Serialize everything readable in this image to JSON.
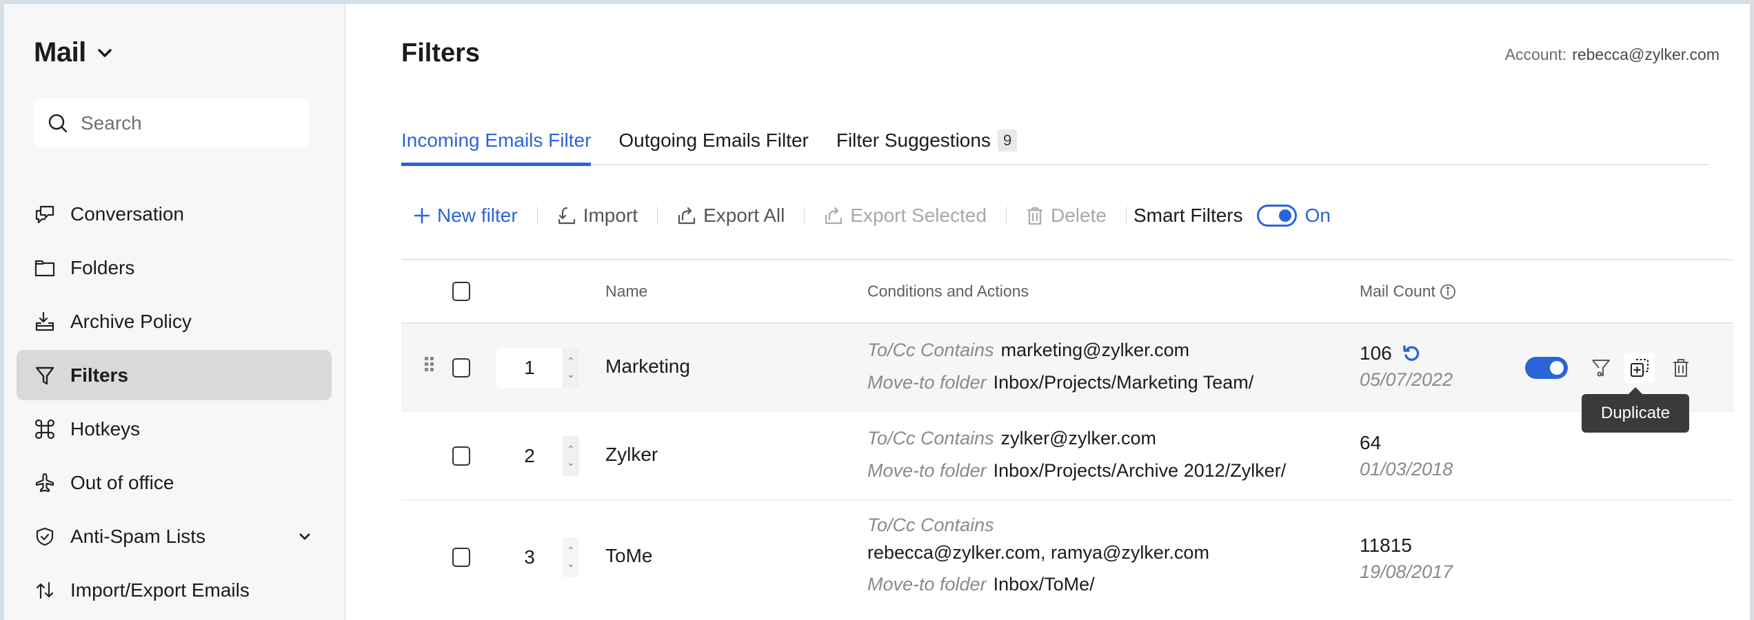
{
  "sidebar": {
    "app_title": "Mail",
    "search_placeholder": "Search",
    "items": [
      {
        "label": "Conversation",
        "icon": "conversation-icon"
      },
      {
        "label": "Folders",
        "icon": "folder-icon"
      },
      {
        "label": "Archive Policy",
        "icon": "archive-icon"
      },
      {
        "label": "Filters",
        "icon": "filter-icon",
        "active": true
      },
      {
        "label": "Hotkeys",
        "icon": "command-icon"
      },
      {
        "label": "Out of office",
        "icon": "airplane-icon"
      },
      {
        "label": "Anti-Spam Lists",
        "icon": "shield-check-icon",
        "expandable": true
      },
      {
        "label": "Import/Export Emails",
        "icon": "import-export-icon"
      }
    ]
  },
  "header": {
    "title": "Filters",
    "account_label": "Account:",
    "account_email": "rebecca@zylker.com"
  },
  "tabs": [
    {
      "label": "Incoming Emails Filter",
      "active": true
    },
    {
      "label": "Outgoing Emails Filter"
    },
    {
      "label": "Filter Suggestions",
      "badge": "9"
    }
  ],
  "toolbar": {
    "new_filter": "New filter",
    "import": "Import",
    "export_all": "Export All",
    "export_selected": "Export Selected",
    "delete": "Delete",
    "smart_filters": "Smart Filters",
    "smart_filters_state": "On"
  },
  "table": {
    "columns": [
      "Name",
      "Conditions and Actions",
      "Mail Count"
    ],
    "rows": [
      {
        "order": "1",
        "name": "Marketing",
        "condition_label": "To/Cc Contains",
        "condition_value": "marketing@zylker.com",
        "action_label": "Move-to folder",
        "action_value": "Inbox/Projects/Marketing Team/",
        "count": "106",
        "date": "05/07/2022",
        "enabled": true
      },
      {
        "order": "2",
        "name": "Zylker",
        "condition_label": "To/Cc Contains",
        "condition_value": "zylker@zylker.com",
        "action_label": "Move-to folder",
        "action_value": "Inbox/Projects/Archive 2012/Zylker/",
        "count": "64",
        "date": "01/03/2018"
      },
      {
        "order": "3",
        "name": "ToMe",
        "condition_label": "To/Cc Contains",
        "condition_value": "rebecca@zylker.com, ramya@zylker.com",
        "action_label": "Move-to folder",
        "action_value": "Inbox/ToMe/",
        "count": "11815",
        "date": "19/08/2017"
      }
    ]
  },
  "tooltip": "Duplicate",
  "colors": {
    "accent": "#2a64d9",
    "tooltip_bg": "#3a3a3a",
    "sidebar_active": "#d9d9db"
  }
}
